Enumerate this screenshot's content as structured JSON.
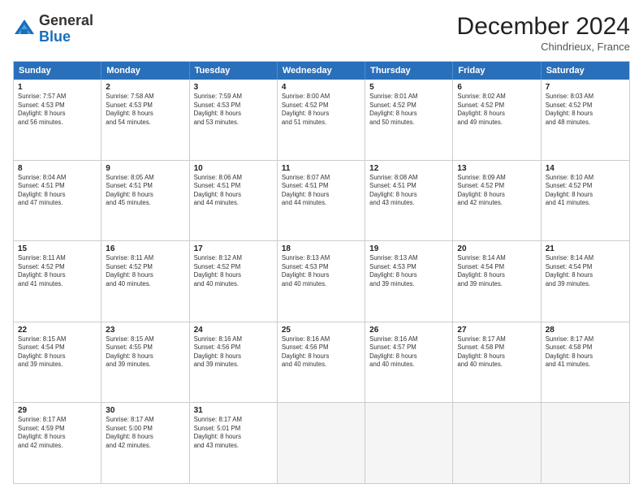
{
  "header": {
    "logo_general": "General",
    "logo_blue": "Blue",
    "month_title": "December 2024",
    "location": "Chindrieux, France"
  },
  "days_of_week": [
    "Sunday",
    "Monday",
    "Tuesday",
    "Wednesday",
    "Thursday",
    "Friday",
    "Saturday"
  ],
  "weeks": [
    [
      {
        "day": "1",
        "lines": [
          "Sunrise: 7:57 AM",
          "Sunset: 4:53 PM",
          "Daylight: 8 hours",
          "and 56 minutes."
        ]
      },
      {
        "day": "2",
        "lines": [
          "Sunrise: 7:58 AM",
          "Sunset: 4:53 PM",
          "Daylight: 8 hours",
          "and 54 minutes."
        ]
      },
      {
        "day": "3",
        "lines": [
          "Sunrise: 7:59 AM",
          "Sunset: 4:53 PM",
          "Daylight: 8 hours",
          "and 53 minutes."
        ]
      },
      {
        "day": "4",
        "lines": [
          "Sunrise: 8:00 AM",
          "Sunset: 4:52 PM",
          "Daylight: 8 hours",
          "and 51 minutes."
        ]
      },
      {
        "day": "5",
        "lines": [
          "Sunrise: 8:01 AM",
          "Sunset: 4:52 PM",
          "Daylight: 8 hours",
          "and 50 minutes."
        ]
      },
      {
        "day": "6",
        "lines": [
          "Sunrise: 8:02 AM",
          "Sunset: 4:52 PM",
          "Daylight: 8 hours",
          "and 49 minutes."
        ]
      },
      {
        "day": "7",
        "lines": [
          "Sunrise: 8:03 AM",
          "Sunset: 4:52 PM",
          "Daylight: 8 hours",
          "and 48 minutes."
        ]
      }
    ],
    [
      {
        "day": "8",
        "lines": [
          "Sunrise: 8:04 AM",
          "Sunset: 4:51 PM",
          "Daylight: 8 hours",
          "and 47 minutes."
        ]
      },
      {
        "day": "9",
        "lines": [
          "Sunrise: 8:05 AM",
          "Sunset: 4:51 PM",
          "Daylight: 8 hours",
          "and 45 minutes."
        ]
      },
      {
        "day": "10",
        "lines": [
          "Sunrise: 8:06 AM",
          "Sunset: 4:51 PM",
          "Daylight: 8 hours",
          "and 44 minutes."
        ]
      },
      {
        "day": "11",
        "lines": [
          "Sunrise: 8:07 AM",
          "Sunset: 4:51 PM",
          "Daylight: 8 hours",
          "and 44 minutes."
        ]
      },
      {
        "day": "12",
        "lines": [
          "Sunrise: 8:08 AM",
          "Sunset: 4:51 PM",
          "Daylight: 8 hours",
          "and 43 minutes."
        ]
      },
      {
        "day": "13",
        "lines": [
          "Sunrise: 8:09 AM",
          "Sunset: 4:52 PM",
          "Daylight: 8 hours",
          "and 42 minutes."
        ]
      },
      {
        "day": "14",
        "lines": [
          "Sunrise: 8:10 AM",
          "Sunset: 4:52 PM",
          "Daylight: 8 hours",
          "and 41 minutes."
        ]
      }
    ],
    [
      {
        "day": "15",
        "lines": [
          "Sunrise: 8:11 AM",
          "Sunset: 4:52 PM",
          "Daylight: 8 hours",
          "and 41 minutes."
        ]
      },
      {
        "day": "16",
        "lines": [
          "Sunrise: 8:11 AM",
          "Sunset: 4:52 PM",
          "Daylight: 8 hours",
          "and 40 minutes."
        ]
      },
      {
        "day": "17",
        "lines": [
          "Sunrise: 8:12 AM",
          "Sunset: 4:52 PM",
          "Daylight: 8 hours",
          "and 40 minutes."
        ]
      },
      {
        "day": "18",
        "lines": [
          "Sunrise: 8:13 AM",
          "Sunset: 4:53 PM",
          "Daylight: 8 hours",
          "and 40 minutes."
        ]
      },
      {
        "day": "19",
        "lines": [
          "Sunrise: 8:13 AM",
          "Sunset: 4:53 PM",
          "Daylight: 8 hours",
          "and 39 minutes."
        ]
      },
      {
        "day": "20",
        "lines": [
          "Sunrise: 8:14 AM",
          "Sunset: 4:54 PM",
          "Daylight: 8 hours",
          "and 39 minutes."
        ]
      },
      {
        "day": "21",
        "lines": [
          "Sunrise: 8:14 AM",
          "Sunset: 4:54 PM",
          "Daylight: 8 hours",
          "and 39 minutes."
        ]
      }
    ],
    [
      {
        "day": "22",
        "lines": [
          "Sunrise: 8:15 AM",
          "Sunset: 4:54 PM",
          "Daylight: 8 hours",
          "and 39 minutes."
        ]
      },
      {
        "day": "23",
        "lines": [
          "Sunrise: 8:15 AM",
          "Sunset: 4:55 PM",
          "Daylight: 8 hours",
          "and 39 minutes."
        ]
      },
      {
        "day": "24",
        "lines": [
          "Sunrise: 8:16 AM",
          "Sunset: 4:56 PM",
          "Daylight: 8 hours",
          "and 39 minutes."
        ]
      },
      {
        "day": "25",
        "lines": [
          "Sunrise: 8:16 AM",
          "Sunset: 4:56 PM",
          "Daylight: 8 hours",
          "and 40 minutes."
        ]
      },
      {
        "day": "26",
        "lines": [
          "Sunrise: 8:16 AM",
          "Sunset: 4:57 PM",
          "Daylight: 8 hours",
          "and 40 minutes."
        ]
      },
      {
        "day": "27",
        "lines": [
          "Sunrise: 8:17 AM",
          "Sunset: 4:58 PM",
          "Daylight: 8 hours",
          "and 40 minutes."
        ]
      },
      {
        "day": "28",
        "lines": [
          "Sunrise: 8:17 AM",
          "Sunset: 4:58 PM",
          "Daylight: 8 hours",
          "and 41 minutes."
        ]
      }
    ],
    [
      {
        "day": "29",
        "lines": [
          "Sunrise: 8:17 AM",
          "Sunset: 4:59 PM",
          "Daylight: 8 hours",
          "and 42 minutes."
        ]
      },
      {
        "day": "30",
        "lines": [
          "Sunrise: 8:17 AM",
          "Sunset: 5:00 PM",
          "Daylight: 8 hours",
          "and 42 minutes."
        ]
      },
      {
        "day": "31",
        "lines": [
          "Sunrise: 8:17 AM",
          "Sunset: 5:01 PM",
          "Daylight: 8 hours",
          "and 43 minutes."
        ]
      },
      {
        "day": "",
        "lines": []
      },
      {
        "day": "",
        "lines": []
      },
      {
        "day": "",
        "lines": []
      },
      {
        "day": "",
        "lines": []
      }
    ]
  ]
}
